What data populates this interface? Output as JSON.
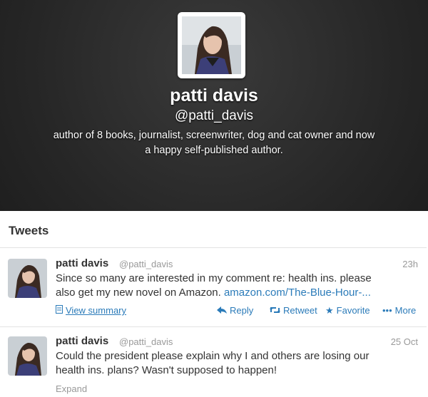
{
  "profile": {
    "name": "patti davis",
    "handle": "@patti_davis",
    "bio_line1": "author of 8 books, journalist, screenwriter, dog and cat owner and now",
    "bio_line2": "a happy self-published author."
  },
  "section_title": "Tweets",
  "tweets": [
    {
      "name": "patti davis",
      "handle": "@patti_davis",
      "time": "23h",
      "text_line1": "Since so many are interested in my comment re: health ins. please",
      "text_line2": "also get my new novel on Amazon.",
      "link": "amazon.com/The-Blue-Hour-...",
      "actions": {
        "summary": "View summary",
        "reply": "Reply",
        "retweet": "Retweet",
        "favorite": "Favorite",
        "more": "More"
      }
    },
    {
      "name": "patti davis",
      "handle": "@patti_davis",
      "time": "25 Oct",
      "text_line1": "Could the president please explain why I and others are losing our",
      "text_line2": "health ins. plans? Wasn't supposed to happen!",
      "expand": "Expand"
    }
  ],
  "icons": {
    "summary": "document-icon",
    "reply": "reply-arrow-icon",
    "retweet": "retweet-icon",
    "favorite": "star-icon",
    "more": "dots-icon"
  },
  "colors": {
    "header_bg": "#2b2b2b",
    "link": "#2b7bb9",
    "muted": "#999999",
    "text": "#333333"
  }
}
